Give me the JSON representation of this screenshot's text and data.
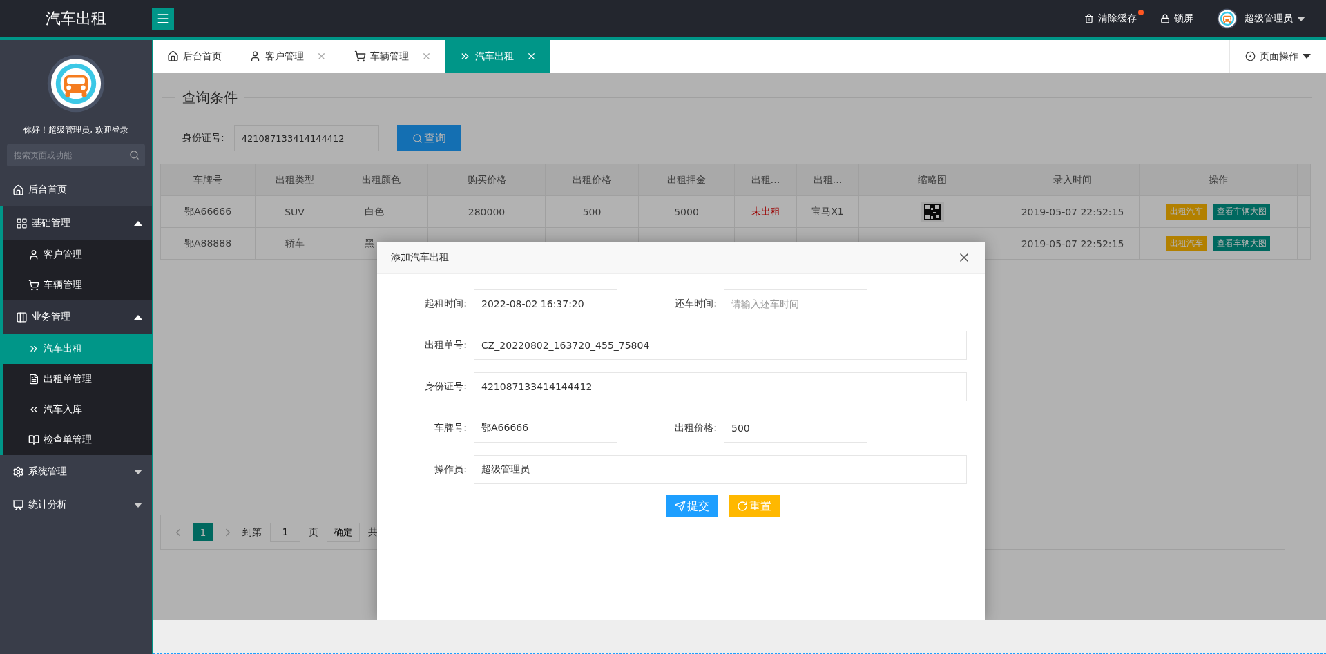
{
  "app": {
    "title": "汽车出租"
  },
  "header": {
    "clear_cache": "清除缓存",
    "cache_notice": true,
    "lock": "锁屏",
    "user": "超级管理员"
  },
  "sidebar": {
    "greeting": "你好！超级管理员, 欢迎登录",
    "search": {
      "placeholder": "搜索页面或功能"
    },
    "menu": [
      {
        "label": "后台首页",
        "selected": false
      },
      {
        "label": "基础管理",
        "selected": false,
        "expanded": true,
        "children": [
          {
            "label": "客户管理",
            "selected": false
          },
          {
            "label": "车辆管理",
            "selected": false
          }
        ]
      },
      {
        "label": "业务管理",
        "selected": false,
        "expanded": true,
        "children": [
          {
            "label": "汽车出租",
            "selected": true
          },
          {
            "label": "出租单管理",
            "selected": false
          },
          {
            "label": "汽车入库",
            "selected": false
          },
          {
            "label": "检查单管理",
            "selected": false
          }
        ]
      },
      {
        "label": "系统管理",
        "selected": false,
        "expanded": false
      },
      {
        "label": "统计分析",
        "selected": false,
        "expanded": false
      }
    ]
  },
  "tabs": [
    {
      "label": "后台首页",
      "closable": false,
      "selected": false
    },
    {
      "label": "客户管理",
      "closable": true,
      "selected": false
    },
    {
      "label": "车辆管理",
      "closable": true,
      "selected": false
    },
    {
      "label": "汽车出租",
      "closable": true,
      "selected": true
    }
  ],
  "page_actions": "页面操作",
  "query": {
    "legend": "查询条件",
    "label": "身份证号:",
    "value": "421087133414144412",
    "button": "查询"
  },
  "table": {
    "columns": [
      "车牌号",
      "出租类型",
      "出租颜色",
      "购买价格",
      "出租价格",
      "出租押金",
      "出租…",
      "出租…",
      "缩略图",
      "录入时间",
      "操作"
    ],
    "rows": [
      {
        "plate": "鄂A66666",
        "type": "SUV",
        "paint": "白色",
        "purchase_price": "280000",
        "rent_price": "500",
        "deposit": "5000",
        "status": "未出租",
        "rented": false,
        "model": "宝马X1",
        "thumbnail": true,
        "entered": "2019-05-07 22:52:15",
        "actions": [
          {
            "label": "出租汽车",
            "kind": "warning"
          },
          {
            "label": "查看车辆大图",
            "kind": "normal"
          }
        ]
      },
      {
        "plate": "鄂A88888",
        "type": "轿车",
        "paint": "黑",
        "entered": "2019-05-07 22:52:15",
        "actions": [
          {
            "label": "出租汽车",
            "kind": "warning"
          },
          {
            "label": "查看车辆大图",
            "kind": "normal"
          }
        ]
      }
    ]
  },
  "pagination": {
    "pages": [
      {
        "label": "1",
        "selected": true
      }
    ],
    "goto": "到第",
    "page_value": "1",
    "page_unit": "页",
    "confirm": "确定",
    "total": "共"
  },
  "dialog": {
    "title": "添加汽车出租",
    "fields": [
      {
        "label": "起租时间:",
        "value": "2022-08-02 16:37:20",
        "kind": "half"
      },
      {
        "label": "还车时间:",
        "placeholder": "请输入还车时间",
        "kind": "half"
      },
      {
        "label": "出租单号:",
        "value": "CZ_20220802_163720_455_75804",
        "kind": "full"
      },
      {
        "label": "身份证号:",
        "value": "421087133414144412",
        "kind": "full"
      },
      {
        "label": "车牌号:",
        "value": "鄂A66666",
        "kind": "half"
      },
      {
        "label": "出租价格:",
        "value": "500",
        "kind": "half"
      },
      {
        "label": "操作员:",
        "value": "超级管理员",
        "kind": "full"
      }
    ],
    "buttons": [
      {
        "label": "提交",
        "kind": "submit"
      },
      {
        "label": "重置",
        "kind": "reset"
      }
    ]
  }
}
